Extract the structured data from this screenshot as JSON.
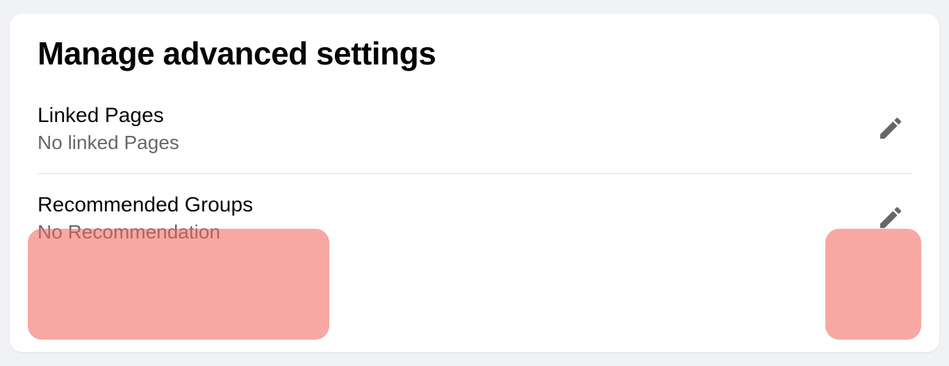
{
  "title": "Manage advanced settings",
  "rows": [
    {
      "label": "Linked Pages",
      "sub": "No linked Pages"
    },
    {
      "label": "Recommended Groups",
      "sub": "No Recommendation"
    }
  ]
}
